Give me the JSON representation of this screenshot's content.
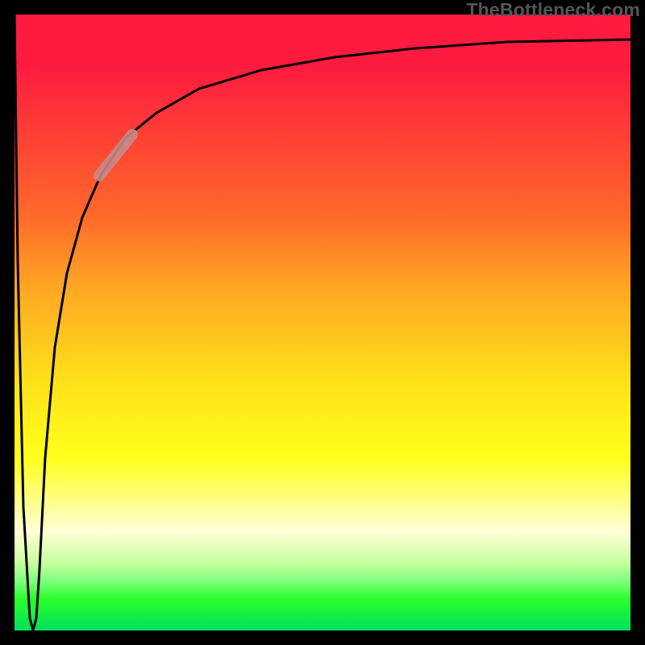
{
  "watermark": "TheBottleneck.com",
  "colors": {
    "frame": "#000000",
    "curve": "#000000",
    "highlight": "#c98b8b",
    "gradient_stops": [
      "#ff1a3f",
      "#ff6a2a",
      "#ffa524",
      "#ffe21a",
      "#ffff1a",
      "#ffff99",
      "#c8ff9e",
      "#2aff2a",
      "#00e060"
    ]
  },
  "chart_data": {
    "type": "line",
    "title": "",
    "xlabel": "",
    "ylabel": "",
    "xlim": [
      0,
      100
    ],
    "ylim": [
      0,
      100
    ],
    "grid": false,
    "legend": false,
    "annotations": [
      "TheBottleneck.com"
    ],
    "series": [
      {
        "name": "curve",
        "x": [
          0,
          0.5,
          1.5,
          2.5,
          3.0,
          3.5,
          4.0,
          5.0,
          6.5,
          8.5,
          11,
          14,
          18,
          23,
          30,
          40,
          52,
          65,
          80,
          100
        ],
        "y": [
          100,
          60,
          20,
          2,
          0,
          2,
          10,
          28,
          46,
          58,
          67,
          74,
          80,
          84,
          88,
          91,
          93,
          94.5,
          95.5,
          96
        ]
      }
    ],
    "highlight_segment": {
      "x_start": 14,
      "x_end": 19,
      "y_start": 74,
      "y_end": 80
    }
  }
}
